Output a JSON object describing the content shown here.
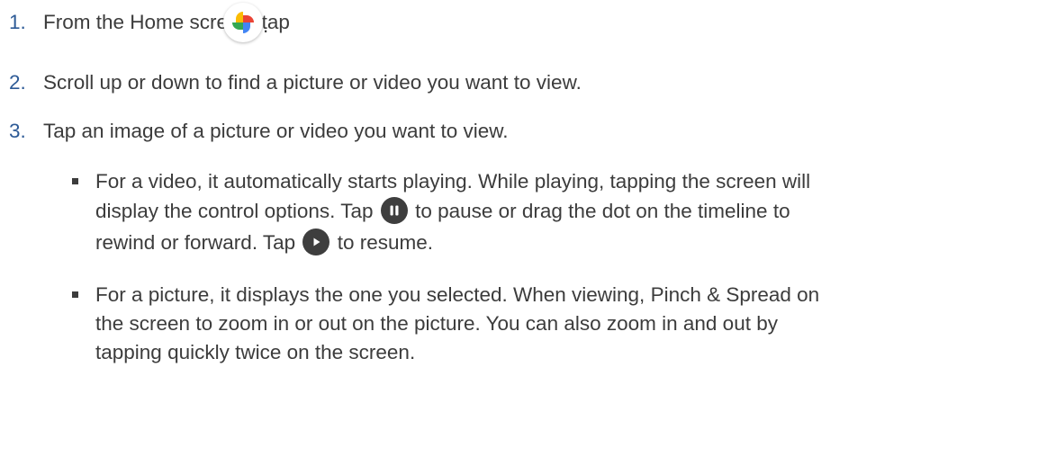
{
  "steps": [
    {
      "number": "1.",
      "text": "From the Home screen, tap",
      "suffix": "."
    },
    {
      "number": "2.",
      "text": "Scroll up or down to find a picture or video you want to view."
    },
    {
      "number": "3.",
      "text": "Tap an image of a picture or video you want to view."
    }
  ],
  "bullets": [
    {
      "lines": [
        "For a video, it automatically starts playing. While playing, tapping the screen will",
        "display the control options. Tap",
        "to pause or drag the dot on the timeline to",
        "rewind or forward. Tap",
        "to resume."
      ]
    },
    {
      "lines": [
        "For a picture, it displays the one you selected. When viewing, Pinch & Spread on",
        "the screen to zoom in or out on the picture. You can also zoom in and out by",
        "tapping quickly twice on the screen."
      ]
    }
  ],
  "icons": {
    "photos": "google-photos-icon",
    "pause": "pause-icon",
    "play": "play-icon"
  },
  "colors": {
    "number": "#2d5a96",
    "text": "#3c3c3c",
    "control_icon": "#3e3e3e"
  }
}
